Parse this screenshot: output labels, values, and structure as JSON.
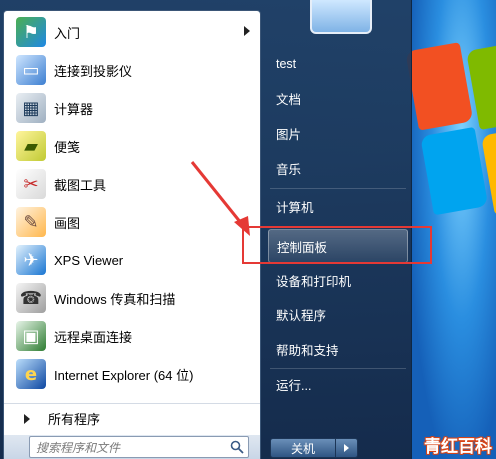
{
  "programs": [
    {
      "label": "入门",
      "icon": "getting-started-icon",
      "has_submenu": true
    },
    {
      "label": "连接到投影仪",
      "icon": "projector-icon",
      "has_submenu": false
    },
    {
      "label": "计算器",
      "icon": "calculator-icon",
      "has_submenu": false
    },
    {
      "label": "便笺",
      "icon": "sticky-notes-icon",
      "has_submenu": false
    },
    {
      "label": "截图工具",
      "icon": "snipping-tool-icon",
      "has_submenu": false
    },
    {
      "label": "画图",
      "icon": "paint-icon",
      "has_submenu": false
    },
    {
      "label": "XPS Viewer",
      "icon": "xps-viewer-icon",
      "has_submenu": false
    },
    {
      "label": "Windows 传真和扫描",
      "icon": "fax-scan-icon",
      "has_submenu": false
    },
    {
      "label": "远程桌面连接",
      "icon": "remote-desktop-icon",
      "has_submenu": false
    },
    {
      "label": "Internet Explorer (64 位)",
      "icon": "internet-explorer-icon",
      "has_submenu": false
    }
  ],
  "all_programs": "所有程序",
  "search": {
    "placeholder": "搜索程序和文件"
  },
  "right": {
    "user": "test",
    "documents": "文档",
    "pictures": "图片",
    "music": "音乐",
    "computer": "计算机",
    "control_panel": "控制面板",
    "devices": "设备和打印机",
    "defaults": "默认程序",
    "help": "帮助和支持",
    "run": "运行..."
  },
  "shutdown": {
    "label": "关机"
  },
  "watermark": "青红百科",
  "colors": {
    "annotation_red": "#e53935",
    "menu_blue": "#1d3b5b"
  }
}
